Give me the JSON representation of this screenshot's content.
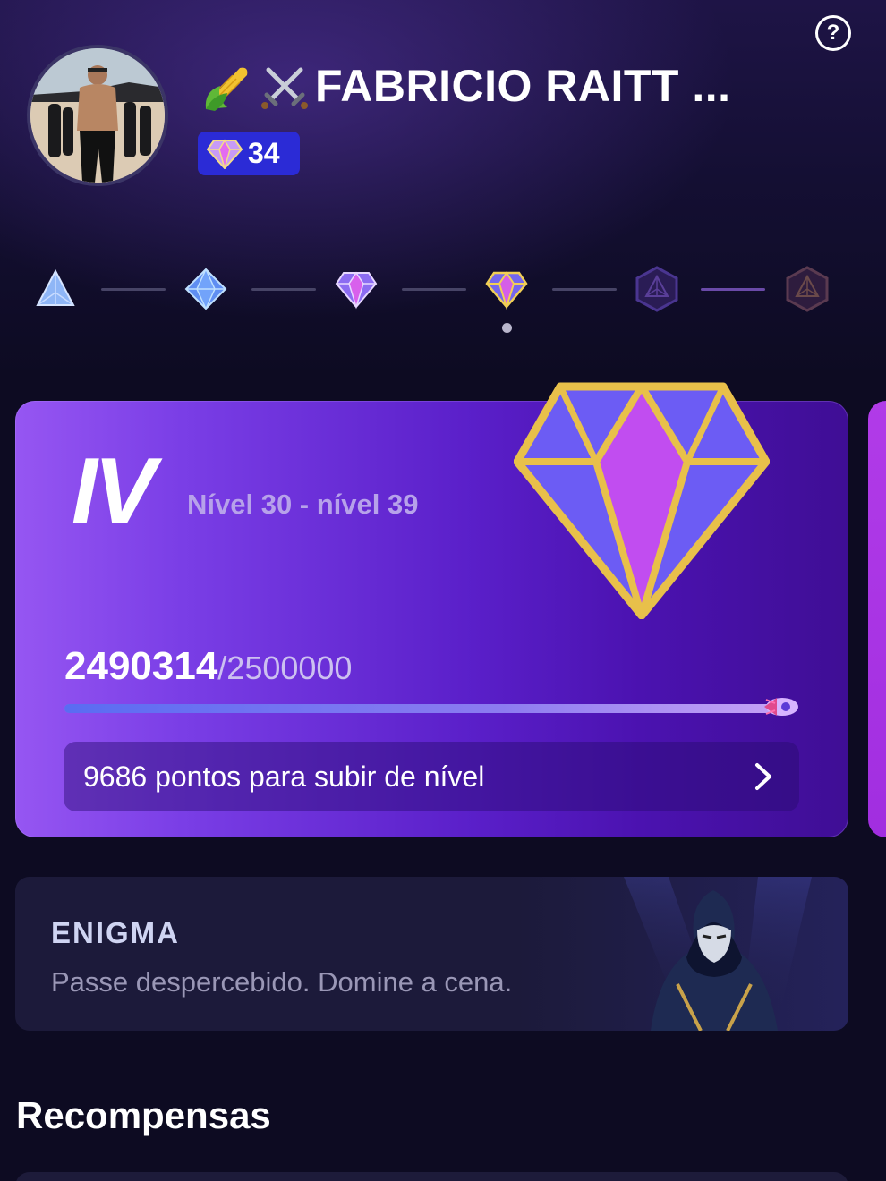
{
  "header": {
    "help_icon": "question-circle-icon",
    "user_name": "FABRICIO RAITT ...",
    "name_emojis": [
      "corn-emoji",
      "crossed-swords-emoji"
    ],
    "gem_count": "34"
  },
  "tiers": {
    "items": [
      {
        "icon": "tier-1-triangle-icon",
        "state": "unlocked"
      },
      {
        "icon": "tier-2-diamond-icon",
        "state": "unlocked"
      },
      {
        "icon": "tier-3-gem-icon",
        "state": "unlocked"
      },
      {
        "icon": "tier-4-gem-icon",
        "state": "current"
      },
      {
        "icon": "tier-5-hex-icon",
        "state": "locked"
      },
      {
        "icon": "tier-6-hex-icon",
        "state": "locked"
      }
    ]
  },
  "level_card": {
    "tier_roman": "IV",
    "range": "Nível 30 - nível 39",
    "points_current": "2490314",
    "points_target": "/2500000",
    "progress_fraction": 0.996,
    "next_level_text": "9686 pontos para subir de nível"
  },
  "enigma": {
    "title": "ENIGMA",
    "subtitle": "Passe despercebido. Domine a cena."
  },
  "rewards": {
    "title": "Recompensas"
  },
  "colors": {
    "background": "#0d0b22",
    "card_purple": "#7a3ee6",
    "gem_badge": "#2b2bd6",
    "gold": "#e8c04a"
  }
}
